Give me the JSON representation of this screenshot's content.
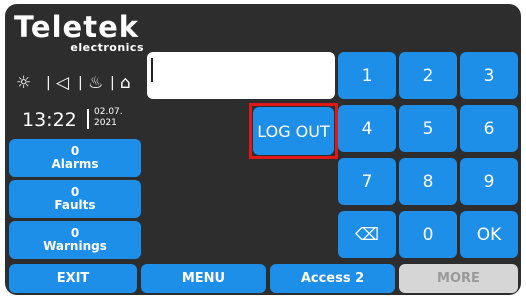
{
  "logo": {
    "name": "Teletek",
    "sub": "electronics"
  },
  "status_icons": [
    "sun-icon",
    "speaker-icon",
    "fire-icon",
    "door-icon"
  ],
  "clock": {
    "time": "13:22",
    "date_line1": "02.07.",
    "date_line2": "2021"
  },
  "counters": [
    {
      "count": "0",
      "label": "Alarms"
    },
    {
      "count": "0",
      "label": "Faults"
    },
    {
      "count": "0",
      "label": "Warnings"
    }
  ],
  "input": {
    "value": ""
  },
  "logout_label": "LOG OUT",
  "keypad": [
    "1",
    "2",
    "3",
    "4",
    "5",
    "6",
    "7",
    "8",
    "9",
    "⌫",
    "0",
    "OK"
  ],
  "bottom": {
    "exit": "EXIT",
    "menu": "MENU",
    "access": "Access 2",
    "more": "MORE"
  },
  "colors": {
    "accent": "#1e8fe8",
    "panel": "#2d2d2d",
    "highlight": "#e01818",
    "disabled": "#d6d6d6"
  }
}
